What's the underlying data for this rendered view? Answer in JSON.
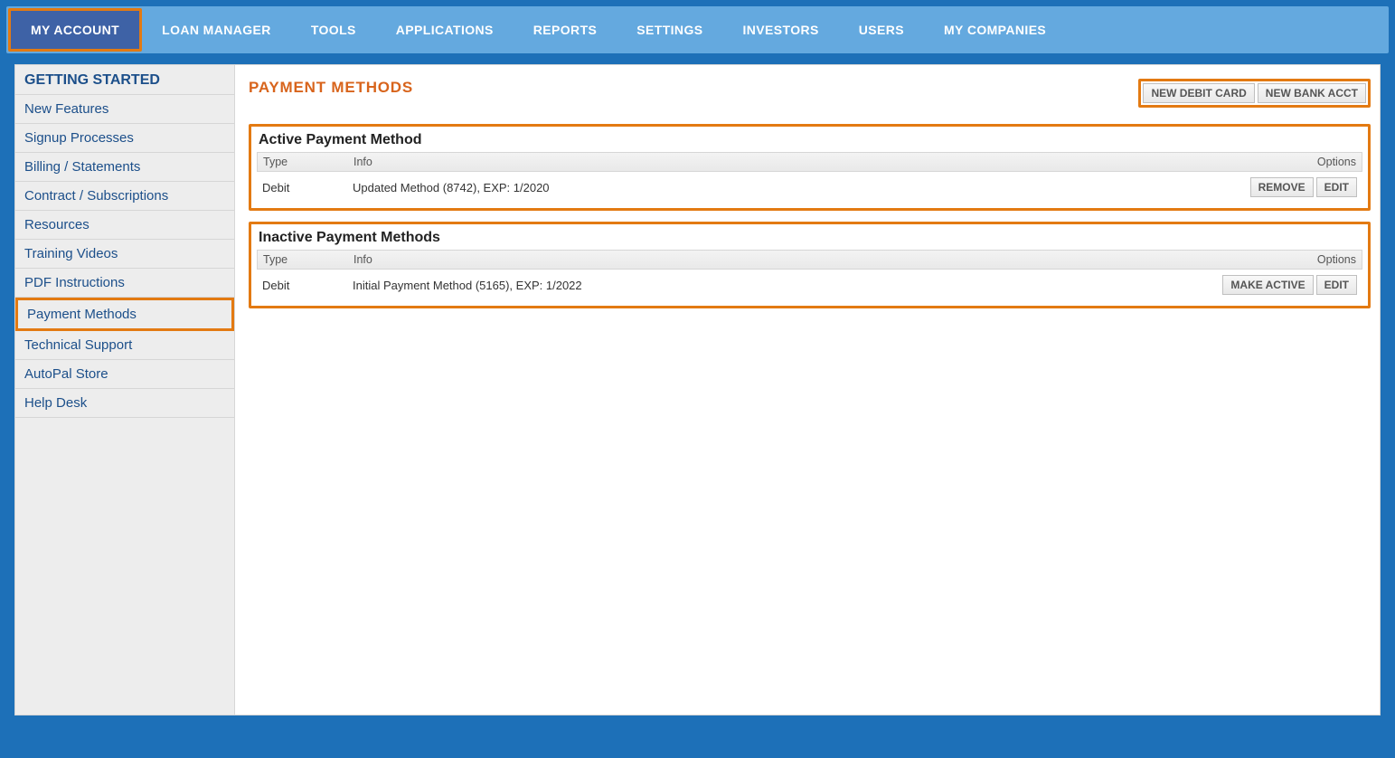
{
  "topnav": {
    "items": [
      {
        "label": "MY ACCOUNT"
      },
      {
        "label": "LOAN MANAGER"
      },
      {
        "label": "TOOLS"
      },
      {
        "label": "APPLICATIONS"
      },
      {
        "label": "REPORTS"
      },
      {
        "label": "SETTINGS"
      },
      {
        "label": "INVESTORS"
      },
      {
        "label": "USERS"
      },
      {
        "label": "MY COMPANIES"
      }
    ]
  },
  "sidebar": {
    "header": "GETTING STARTED",
    "items": [
      {
        "label": "New Features"
      },
      {
        "label": "Signup Processes"
      },
      {
        "label": "Billing / Statements"
      },
      {
        "label": "Contract / Subscriptions"
      },
      {
        "label": "Resources"
      },
      {
        "label": "Training Videos"
      },
      {
        "label": "PDF Instructions"
      },
      {
        "label": "Payment Methods"
      },
      {
        "label": "Technical Support"
      },
      {
        "label": "AutoPal Store"
      },
      {
        "label": "Help Desk"
      }
    ]
  },
  "page": {
    "title": "PAYMENT METHODS",
    "buttons": {
      "new_debit": "NEW DEBIT CARD",
      "new_bank": "NEW BANK ACCT"
    }
  },
  "active_section": {
    "title": "Active Payment Method",
    "headers": {
      "type": "Type",
      "info": "Info",
      "options": "Options"
    },
    "row": {
      "type": "Debit",
      "info": "Updated Method (8742), EXP: 1/2020",
      "remove": "REMOVE",
      "edit": "EDIT"
    }
  },
  "inactive_section": {
    "title": "Inactive Payment Methods",
    "headers": {
      "type": "Type",
      "info": "Info",
      "options": "Options"
    },
    "row": {
      "type": "Debit",
      "info": "Initial Payment Method (5165), EXP: 1/2022",
      "make_active": "MAKE ACTIVE",
      "edit": "EDIT"
    }
  }
}
